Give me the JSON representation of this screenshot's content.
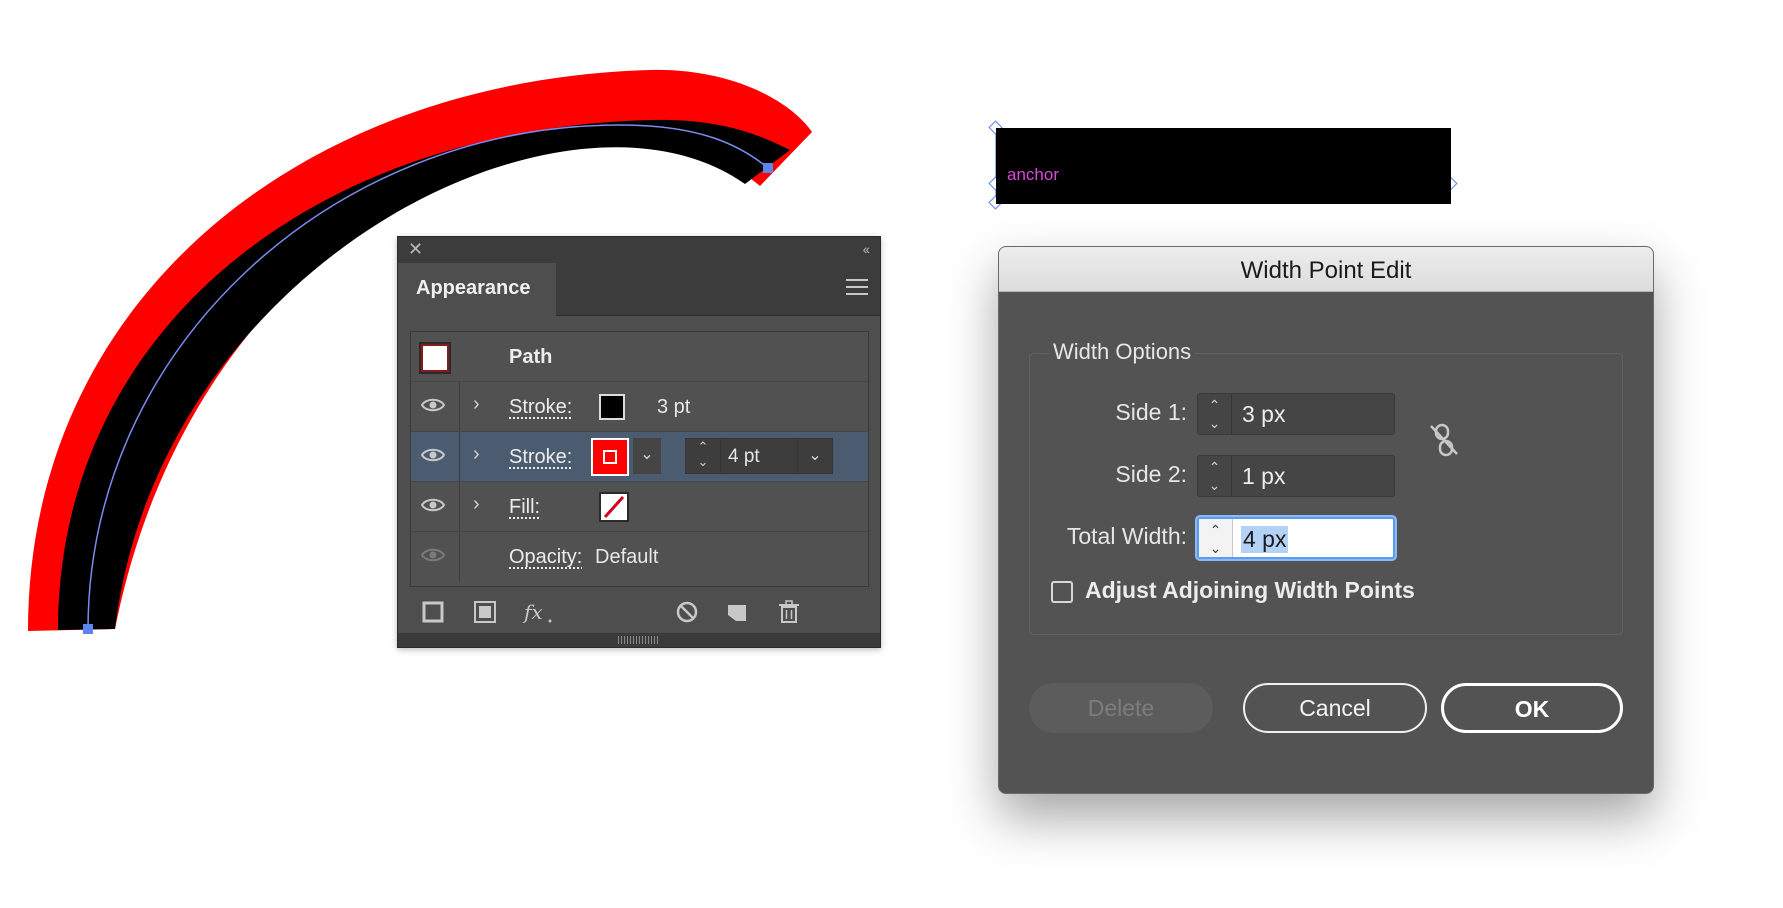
{
  "colors": {
    "stroke_outer": "#ff0000",
    "stroke_inner": "#000000",
    "path_guide": "#7a8cf0",
    "anchor_handle": "#5b86f0",
    "anchor_label": "#d94ad9",
    "panel_bg": "#4e4e4e",
    "selected_row": "#4b5c70",
    "dialog_bg": "#535353",
    "focus_ring": "#5a9cf0"
  },
  "canvas": {
    "anchor_label": "anchor"
  },
  "appearance_panel": {
    "tab_label": "Appearance",
    "close_icon": "close-icon",
    "collapse_icon": "double-chevron-left-icon",
    "menu_icon": "hamburger-menu-icon",
    "rows": [
      {
        "label": "Path",
        "kind": "object"
      },
      {
        "label": "Stroke:",
        "value": "3 pt",
        "swatch": "#000000"
      },
      {
        "label": "Stroke:",
        "value": "4 pt",
        "swatch": "#ff0000",
        "selected": true
      },
      {
        "label": "Fill:",
        "swatch": "none"
      },
      {
        "label": "Opacity:",
        "value": "Default"
      }
    ],
    "footer_icons": [
      "add-new-stroke-icon",
      "add-new-fill-icon",
      "add-new-effect-icon",
      "clear-appearance-icon",
      "duplicate-item-icon",
      "delete-item-icon"
    ]
  },
  "width_point_dialog": {
    "title": "Width Point Edit",
    "group_label": "Width Options",
    "side1_label": "Side 1:",
    "side1_value": "3 px",
    "side2_label": "Side 2:",
    "side2_value": "1 px",
    "total_label": "Total Width:",
    "total_value": "4 px",
    "adjust_label": "Adjust Adjoining Width Points",
    "adjust_checked": false,
    "delete_label": "Delete",
    "cancel_label": "Cancel",
    "ok_label": "OK"
  }
}
